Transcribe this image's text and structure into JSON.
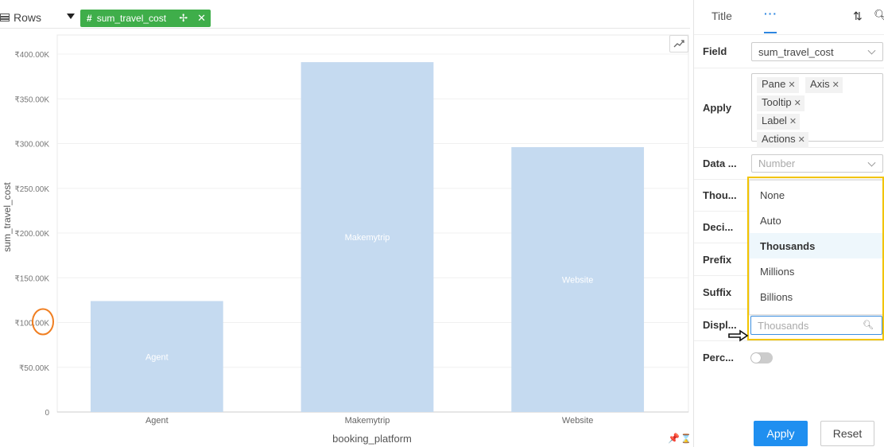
{
  "shelf": {
    "label": "Rows",
    "pill": {
      "field": "sum_travel_cost"
    }
  },
  "chart_data": {
    "type": "bar",
    "categories": [
      "Agent",
      "Makemytrip",
      "Website"
    ],
    "values": [
      124000,
      391000,
      296000
    ],
    "bar_labels": [
      "Agent",
      "Makemytrip",
      "Website"
    ],
    "yticks": [
      "0",
      "₹50.00K",
      "₹100.00K",
      "₹150.00K",
      "₹200.00K",
      "₹250.00K",
      "₹300.00K",
      "₹350.00K",
      "₹400.00K"
    ],
    "ylim": [
      0,
      400000
    ],
    "xlabel": "booking_platform",
    "ylabel": "sum_travel_cost",
    "grid": true,
    "bar_color": "#c5daf0"
  },
  "panel": {
    "tabs": {
      "title": "Title",
      "more": "···"
    },
    "field": {
      "label": "Field",
      "value": "sum_travel_cost"
    },
    "apply": {
      "label": "Apply",
      "chips": [
        "Pane",
        "Axis",
        "Tooltip",
        "Label",
        "Actions"
      ]
    },
    "data_type": {
      "label": "Data ...",
      "value": "Number"
    },
    "thousands": {
      "label": "Thou..."
    },
    "decimals": {
      "label": "Deci..."
    },
    "prefix": {
      "label": "Prefix"
    },
    "suffix": {
      "label": "Suffix"
    },
    "display": {
      "label": "Displ...",
      "placeholder": "Thousands"
    },
    "percent": {
      "label": "Perc..."
    },
    "dropdown_options": [
      "None",
      "Auto",
      "Thousands",
      "Millions",
      "Billions"
    ],
    "selected_option": "Thousands",
    "apply_button": "Apply",
    "reset_button": "Reset"
  },
  "colors": {
    "accent": "#1f8ff0",
    "pill": "#3fae4a",
    "highlight": "#f2c400",
    "annotation": "#f07f22"
  }
}
